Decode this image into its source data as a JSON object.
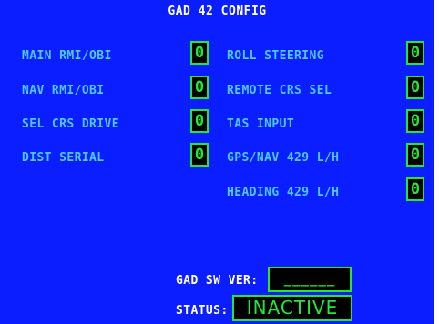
{
  "title": "GAD 42 CONFIG",
  "left_items": [
    {
      "label": "MAIN RMI/OBI",
      "value": "0"
    },
    {
      "label": "NAV RMI/OBI",
      "value": "0"
    },
    {
      "label": "SEL CRS DRIVE",
      "value": "0"
    },
    {
      "label": "DIST SERIAL",
      "value": "0"
    }
  ],
  "right_items": [
    {
      "label": "ROLL STEERING",
      "value": "0"
    },
    {
      "label": "REMOTE CRS SEL",
      "value": "0"
    },
    {
      "label": "TAS INPUT",
      "value": "0"
    },
    {
      "label": "GPS/NAV 429 L/H",
      "value": "0"
    },
    {
      "label": "HEADING 429 L/H",
      "value": "0"
    }
  ],
  "sw_version": {
    "label": "GAD SW VER:",
    "value": "______"
  },
  "status": {
    "label": "STATUS:",
    "value": "INACTIVE"
  },
  "colors": {
    "background": "#0a1eff",
    "label": "#4fc8ff",
    "value": "#22e832",
    "title": "#ffffff"
  }
}
